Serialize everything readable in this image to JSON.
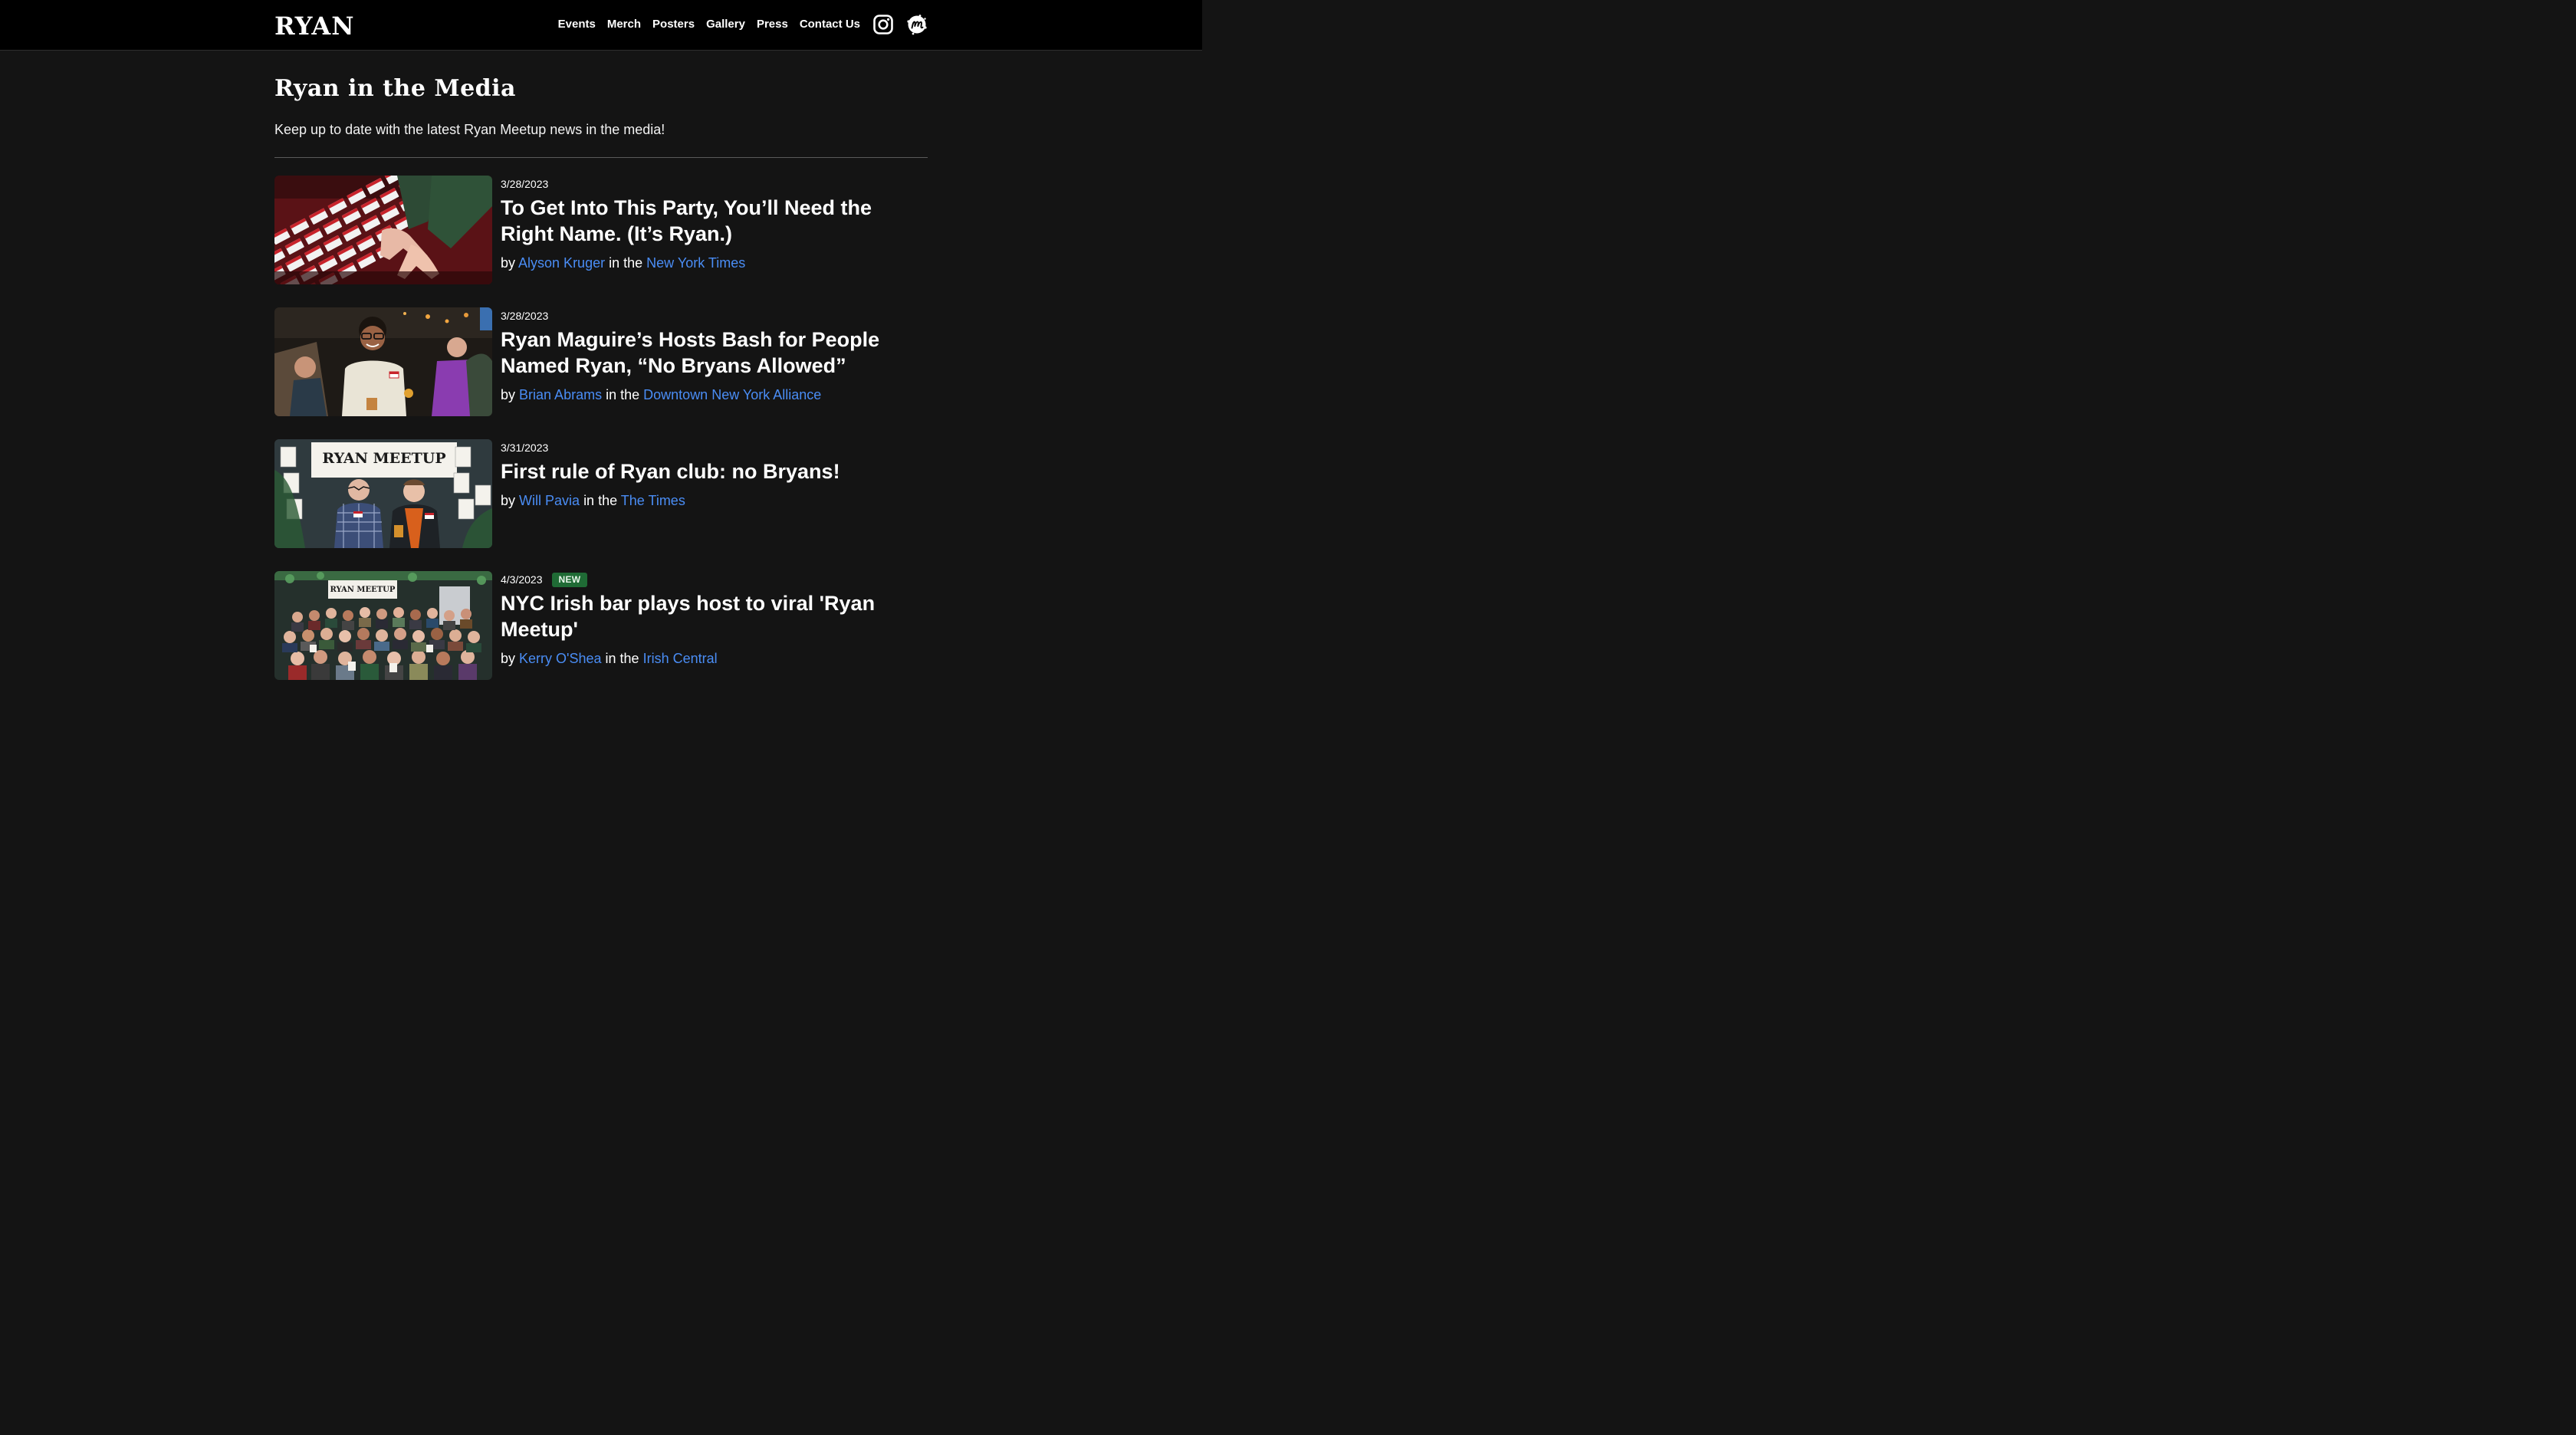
{
  "header": {
    "logo": "RYAN",
    "nav": [
      "Events",
      "Merch",
      "Posters",
      "Gallery",
      "Press",
      "Contact Us"
    ],
    "icons": [
      "instagram-icon",
      "meetup-icon"
    ]
  },
  "page": {
    "title": "Ryan in the Media",
    "subtitle": "Keep up to date with the latest Ryan Meetup news in the media!"
  },
  "byline_parts": {
    "by": "by",
    "in_the": "in the"
  },
  "articles": [
    {
      "date": "3/28/2023",
      "badge": "",
      "headline": "To Get Into This Party, You’ll Need the Right Name. (It’s Ryan.)",
      "author": "Alyson Kruger",
      "publication": "New York Times"
    },
    {
      "date": "3/28/2023",
      "badge": "",
      "headline": "Ryan Maguire’s Hosts Bash for People Named Ryan, “No Bryans Allowed”",
      "author": "Brian Abrams",
      "publication": "Downtown New York Alliance"
    },
    {
      "date": "3/31/2023",
      "badge": "",
      "headline": "First rule of Ryan club: no Bryans!",
      "author": "Will Pavia",
      "publication": "The Times"
    },
    {
      "date": "4/3/2023",
      "badge": "NEW",
      "headline": "NYC Irish bar plays host to viral 'Ryan Meetup'",
      "author": "Kerry O'Shea",
      "publication": "Irish Central"
    }
  ],
  "thumb_text": {
    "banner_1": "RYAN MEETUP",
    "banner_2": "RYAN MEETUP"
  },
  "colors": {
    "background": "#141414",
    "header": "#000000",
    "link": "#4a8df5",
    "badge": "#1f6b35"
  }
}
